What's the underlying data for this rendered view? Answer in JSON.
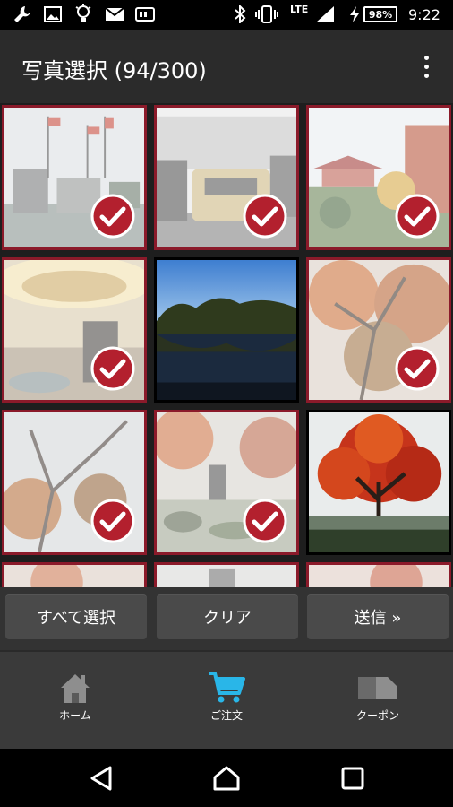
{
  "status_bar": {
    "icons": [
      "wrench-icon",
      "image-icon",
      "bulb-icon",
      "mail-icon",
      "card-icon",
      "bluetooth-icon",
      "vibrate-icon",
      "signal-icon",
      "charging-icon"
    ],
    "network": "LTE",
    "battery": "98%",
    "time": "9:22"
  },
  "app_bar": {
    "title": "写真選択 (94/300)"
  },
  "photos": [
    {
      "selected": true,
      "scene": "city-flags"
    },
    {
      "selected": true,
      "scene": "street-car"
    },
    {
      "selected": true,
      "scene": "pagoda-garden"
    },
    {
      "selected": true,
      "scene": "hotel-lobby"
    },
    {
      "selected": false,
      "scene": "lake-trees"
    },
    {
      "selected": true,
      "scene": "autumn-branches"
    },
    {
      "selected": true,
      "scene": "autumn-tree"
    },
    {
      "selected": true,
      "scene": "garden-rocks"
    },
    {
      "selected": false,
      "scene": "red-maple"
    },
    {
      "selected": true,
      "scene": "partial"
    },
    {
      "selected": true,
      "scene": "partial"
    },
    {
      "selected": true,
      "scene": "partial"
    }
  ],
  "actions": {
    "select_all": "すべて選択",
    "clear": "クリア",
    "send": "送信 »"
  },
  "tabs": {
    "home": "ホーム",
    "order": "ご注文",
    "coupon": "クーポン"
  },
  "colors": {
    "selected_border": "#8b1a2a",
    "check_red": "#b3202e",
    "accent_cart": "#29b6e8"
  }
}
